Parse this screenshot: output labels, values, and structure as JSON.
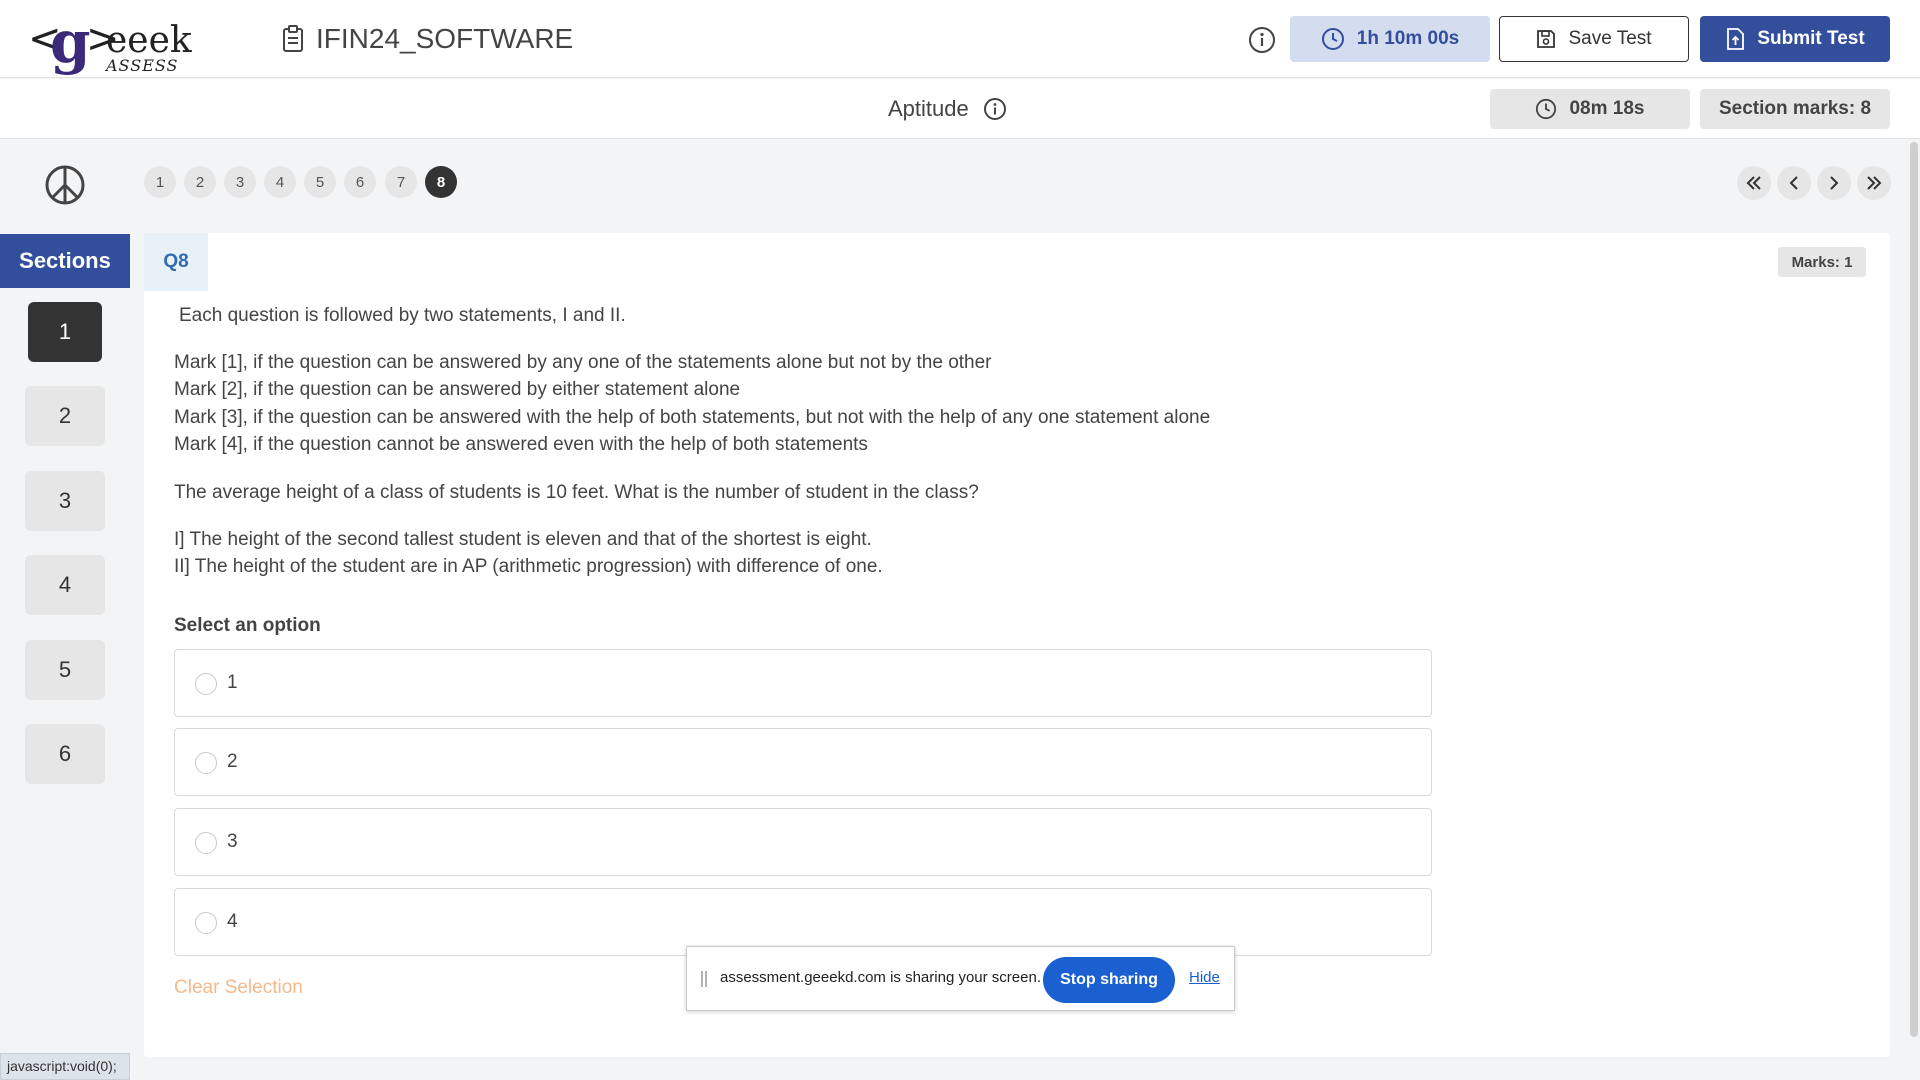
{
  "header": {
    "logo_word": "eeek",
    "logo_sub": "ASSESS",
    "test_title": "IFIN24_SOFTWARE",
    "timer": "1h 10m 00s",
    "save_label": "Save Test",
    "submit_label": "Submit Test"
  },
  "section_bar": {
    "name": "Aptitude",
    "timer": "08m 18s",
    "marks": "Section marks: 8"
  },
  "sidebar": {
    "heading": "Sections",
    "sections": [
      "1",
      "2",
      "3",
      "4",
      "5",
      "6"
    ],
    "active_section": "1",
    "status_url": "javascript:void(0);"
  },
  "question_nav": {
    "numbers": [
      "1",
      "2",
      "3",
      "4",
      "5",
      "6",
      "7",
      "8"
    ],
    "current": "8"
  },
  "question": {
    "label": "Q8",
    "marks": "Marks: 1",
    "intro": "Each question is followed by two statements, I and II.",
    "rules": [
      "Mark [1], if the question can be answered by any one of the statements alone but not by the other",
      "Mark [2], if the question can be answered by either statement alone",
      "Mark [3], if the question can be answered with the help of both statements, but not with the help of any one statement alone",
      "Mark [4], if the question cannot be answered even with the help of both statements"
    ],
    "prompt": "The average height of a class of students is 10 feet. What is the number of student in the class?",
    "statements": [
      "I] The height of the second tallest student is eleven and that of the shortest is eight.",
      "II] The height of the student are in AP (arithmetic progression) with difference of one."
    ],
    "select_label": "Select an option",
    "options": [
      "1",
      "2",
      "3",
      "4"
    ],
    "clear_label": "Clear Selection"
  },
  "share_bar": {
    "text": "assessment.geeekd.com is sharing your screen.",
    "stop_label": "Stop sharing",
    "hide_label": "Hide"
  },
  "colors": {
    "primary": "#334e9b",
    "timer_bg": "#d4dcef",
    "clear_selection": "#f5b98a",
    "share_button": "#1a60d0"
  },
  "icons": {
    "test_title": "clipboard-icon",
    "info": "info-icon",
    "timer": "clock-icon",
    "save": "floppy-disk-icon",
    "submit": "file-upload-icon",
    "palette": "peace-sign-icon",
    "nav_first": "double-chevron-left-icon",
    "nav_prev": "chevron-left-icon",
    "nav_next": "chevron-right-icon",
    "nav_last": "double-chevron-right-icon"
  }
}
